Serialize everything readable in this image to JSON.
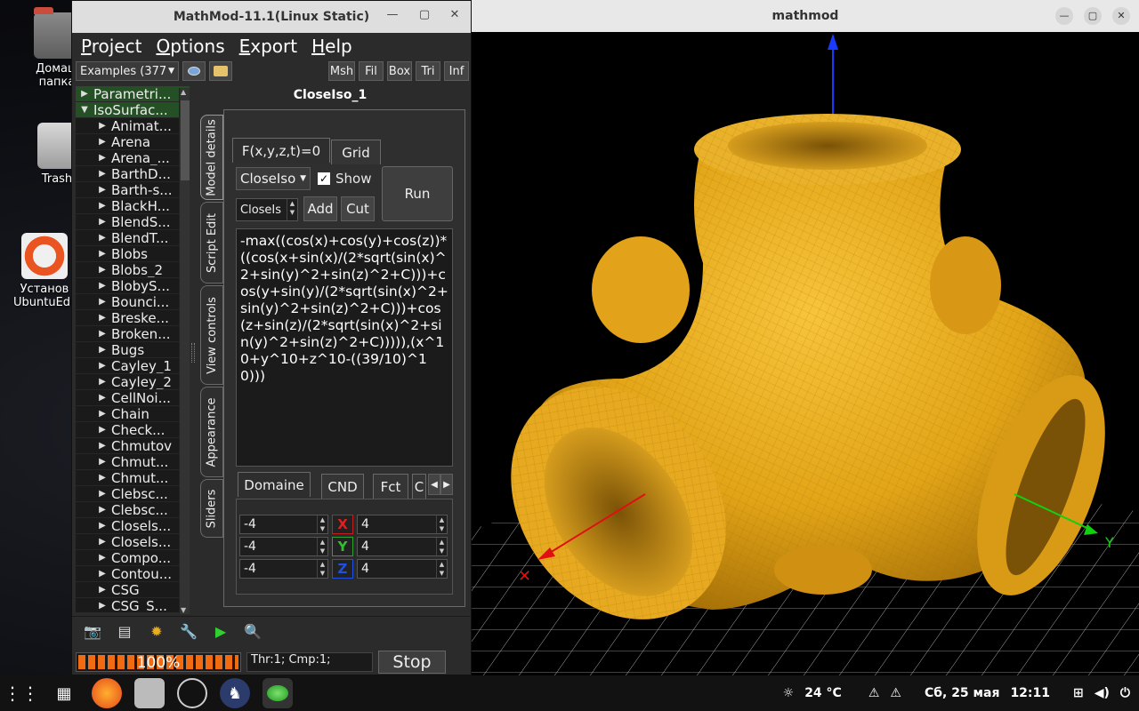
{
  "desktop": {
    "icons": [
      {
        "label": "Домаш папка"
      },
      {
        "label": "Trash"
      },
      {
        "label": "Установ UbuntuEdu"
      }
    ]
  },
  "mathmod": {
    "title": "MathMod-11.1(Linux Static)",
    "menu": [
      "Project",
      "Options",
      "Export",
      "Help"
    ],
    "examples_combo": "Examples (377",
    "view_buttons": [
      "Msh",
      "Fil",
      "Box",
      "Tri",
      "Inf"
    ],
    "tree": {
      "roots": [
        "Parametri...",
        "IsoSurfac..."
      ],
      "items": [
        "Animat...",
        "Arena",
        "Arena_...",
        "BarthD...",
        "Barth-s...",
        "BlackH...",
        "BlendS...",
        "BlendT...",
        "Blobs",
        "Blobs_2",
        "BlobyS...",
        "Bounci...",
        "Breske...",
        "Broken...",
        "Bugs",
        "Cayley_1",
        "Cayley_2",
        "CellNoi...",
        "Chain",
        "Check...",
        "Chmutov",
        "Chmut...",
        "Chmut...",
        "Clebsc...",
        "Clebsc...",
        "Closels...",
        "Closels...",
        "Compo...",
        "Contou...",
        "CSG",
        "CSG_S..."
      ]
    },
    "panel_title": "CloseIso_1",
    "side_tabs": [
      "Model details",
      "Script Edit",
      "View controls",
      "Appearance",
      "Sliders"
    ],
    "top_tabs": [
      "F(x,y,z,t)=0",
      "Grid"
    ],
    "func_combo": "CloseIso",
    "show_label": "Show",
    "run_label": "Run",
    "name_spin": "CloseIs",
    "add_label": "Add",
    "cut_label": "Cut",
    "formula": "-max((cos(x)+cos(y)+cos(z))*((cos(x+sin(x)/(2*sqrt(sin(x)^2+sin(y)^2+sin(z)^2+C)))+cos(y+sin(y)/(2*sqrt(sin(x)^2+sin(y)^2+sin(z)^2+C)))+cos(z+sin(z)/(2*sqrt(sin(x)^2+sin(y)^2+sin(z)^2+C))))),(x^10+y^10+z^10-((39/10)^10)))",
    "bottom_tabs": [
      "Domaine",
      "CND",
      "Fct",
      "C"
    ],
    "domain": [
      {
        "axis": "X",
        "min": "-4",
        "max": "4",
        "color": "#e02020"
      },
      {
        "axis": "Y",
        "min": "-4",
        "max": "4",
        "color": "#30c030"
      },
      {
        "axis": "Z",
        "min": "-4",
        "max": "4",
        "color": "#2050e0"
      }
    ],
    "progress_text": "100%",
    "progress_value": 1.0,
    "status_text": "Thr:1; Cmp:1;",
    "stop_label": "Stop"
  },
  "viewer": {
    "title": "mathmod"
  },
  "taskbar": {
    "temperature": "24 °C",
    "date": "Сб, 25 мая",
    "time": "12:11"
  }
}
